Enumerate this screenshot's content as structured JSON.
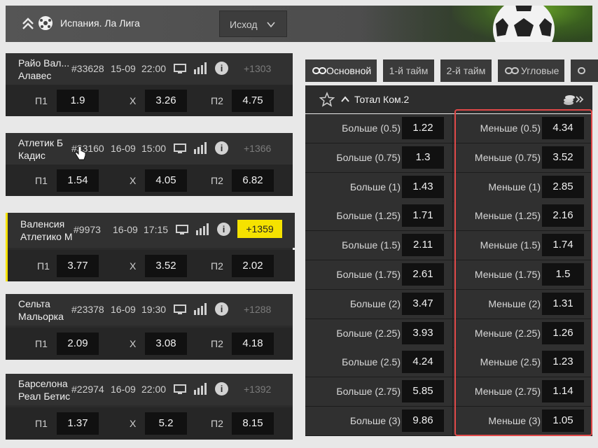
{
  "header": {
    "league": "Испания. Ла Лига",
    "market_select": "Исход"
  },
  "icons": {
    "collapse": "double-chevron-up-icon",
    "sport": "soccer-ball-icon",
    "tv": "tv-icon",
    "stats": "bar-chart-icon",
    "info": "info-icon",
    "star": "star-icon",
    "coins": "coins-icon"
  },
  "matches": [
    {
      "team1": "Райо Вал...",
      "team2": "Алавес",
      "id": "#33628",
      "date": "15-09",
      "time": "22:00",
      "more": "+1303",
      "p1_label": "П1",
      "p1": "1.9",
      "x_label": "Х",
      "x": "3.26",
      "p2_label": "П2",
      "p2": "4.75"
    },
    {
      "team1": "Атлетик Б",
      "team2": "Кадис",
      "id": "#33160",
      "date": "16-09",
      "time": "15:00",
      "more": "+1366",
      "p1_label": "П1",
      "p1": "1.54",
      "x_label": "Х",
      "x": "4.05",
      "p2_label": "П2",
      "p2": "6.82"
    },
    {
      "team1": "Валенсия",
      "team2": "Атлетико М",
      "id": "#9973",
      "date": "16-09",
      "time": "17:15",
      "more": "+1359",
      "p1_label": "П1",
      "p1": "3.77",
      "x_label": "Х",
      "x": "3.52",
      "p2_label": "П2",
      "p2": "2.02"
    },
    {
      "team1": "Сельта",
      "team2": "Мальорка",
      "id": "#23378",
      "date": "16-09",
      "time": "19:30",
      "more": "+1288",
      "p1_label": "П1",
      "p1": "2.09",
      "x_label": "Х",
      "x": "3.08",
      "p2_label": "П2",
      "p2": "4.18"
    },
    {
      "team1": "Барселона",
      "team2": "Реал Бетис",
      "id": "#22974",
      "date": "16-09",
      "time": "22:00",
      "more": "+1392",
      "p1_label": "П1",
      "p1": "1.37",
      "x_label": "Х",
      "x": "5.2",
      "p2_label": "П2",
      "p2": "8.15"
    }
  ],
  "tabs": [
    "Основной",
    "1-й тайм",
    "2-й тайм",
    "Угловые"
  ],
  "market": {
    "title": "Тотал Ком.2",
    "rows": [
      {
        "over": "Больше (0.5)",
        "over_odd": "1.22",
        "under": "Меньше (0.5)",
        "under_odd": "4.34"
      },
      {
        "over": "Больше (0.75)",
        "over_odd": "1.3",
        "under": "Меньше (0.75)",
        "under_odd": "3.52"
      },
      {
        "over": "Больше (1)",
        "over_odd": "1.43",
        "under": "Меньше (1)",
        "under_odd": "2.85"
      },
      {
        "over": "Больше (1.25)",
        "over_odd": "1.71",
        "under": "Меньше (1.25)",
        "under_odd": "2.16"
      },
      {
        "over": "Больше (1.5)",
        "over_odd": "2.11",
        "under": "Меньше (1.5)",
        "under_odd": "1.74"
      },
      {
        "over": "Больше (1.75)",
        "over_odd": "2.61",
        "under": "Меньше (1.75)",
        "under_odd": "1.5"
      },
      {
        "over": "Больше (2)",
        "over_odd": "3.47",
        "under": "Меньше (2)",
        "under_odd": "1.31"
      },
      {
        "over": "Больше (2.25)",
        "over_odd": "3.93",
        "under": "Меньше (2.25)",
        "under_odd": "1.26"
      },
      {
        "over": "Больше (2.5)",
        "over_odd": "4.24",
        "under": "Меньше (2.5)",
        "under_odd": "1.23"
      },
      {
        "over": "Больше (2.75)",
        "over_odd": "5.85",
        "under": "Меньше (2.75)",
        "under_odd": "1.14"
      },
      {
        "over": "Больше (3)",
        "over_odd": "9.86",
        "under": "Меньше (3)",
        "under_odd": "1.05"
      }
    ]
  },
  "colors": {
    "highlight": "#f5e200",
    "frame": "#e04848"
  }
}
